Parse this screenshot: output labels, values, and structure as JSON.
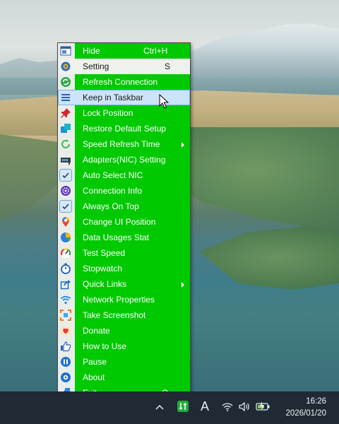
{
  "menu": {
    "items": [
      {
        "label": "Hide",
        "shortcut": "Ctrl+H",
        "icon": "window-icon"
      },
      {
        "label": "Setting",
        "shortcut": "S",
        "icon": "gear-icon"
      },
      {
        "label": "Refresh Connection",
        "icon": "refresh-icon"
      },
      {
        "label": "Keep in Taskbar",
        "icon": "taskbar-icon"
      },
      {
        "label": "Lock Position",
        "icon": "pin-icon"
      },
      {
        "label": "Restore Default Setup",
        "icon": "restore-icon"
      },
      {
        "label": "Speed Refresh Time",
        "icon": "refresh-circle-icon",
        "submenu": true
      },
      {
        "label": "Adapters(NIC) Setting",
        "icon": "network-adapter-icon"
      },
      {
        "label": "Auto Select NIC",
        "icon": "checkmark-icon",
        "checked": true
      },
      {
        "label": "Connection Info",
        "icon": "info-gear-icon"
      },
      {
        "label": "Always On Top",
        "icon": "checkmark-icon",
        "checked": true
      },
      {
        "label": "Change UI Position",
        "icon": "map-pin-icon"
      },
      {
        "label": "Data Usages Stat",
        "icon": "pie-chart-icon"
      },
      {
        "label": "Test Speed",
        "icon": "speedometer-icon"
      },
      {
        "label": "Stopwatch",
        "icon": "stopwatch-icon"
      },
      {
        "label": "Quick Links",
        "icon": "share-icon",
        "submenu": true
      },
      {
        "label": "Network Properties",
        "icon": "wifi-icon"
      },
      {
        "label": "Take Screenshot",
        "icon": "screenshot-icon"
      },
      {
        "label": "Donate",
        "icon": "heart-icon"
      },
      {
        "label": "How to Use",
        "icon": "thumbs-up-icon"
      },
      {
        "label": "Pause",
        "icon": "pause-icon"
      },
      {
        "label": "About",
        "icon": "about-icon"
      },
      {
        "label": "Exit",
        "shortcut": "Q",
        "icon": "exit-icon"
      }
    ],
    "highlighted": "Setting",
    "hovered": "Keep in Taskbar",
    "accent": "#00c900"
  },
  "taskbar": {
    "ime": "A",
    "time": "16:26",
    "date": "2026/01/20"
  }
}
